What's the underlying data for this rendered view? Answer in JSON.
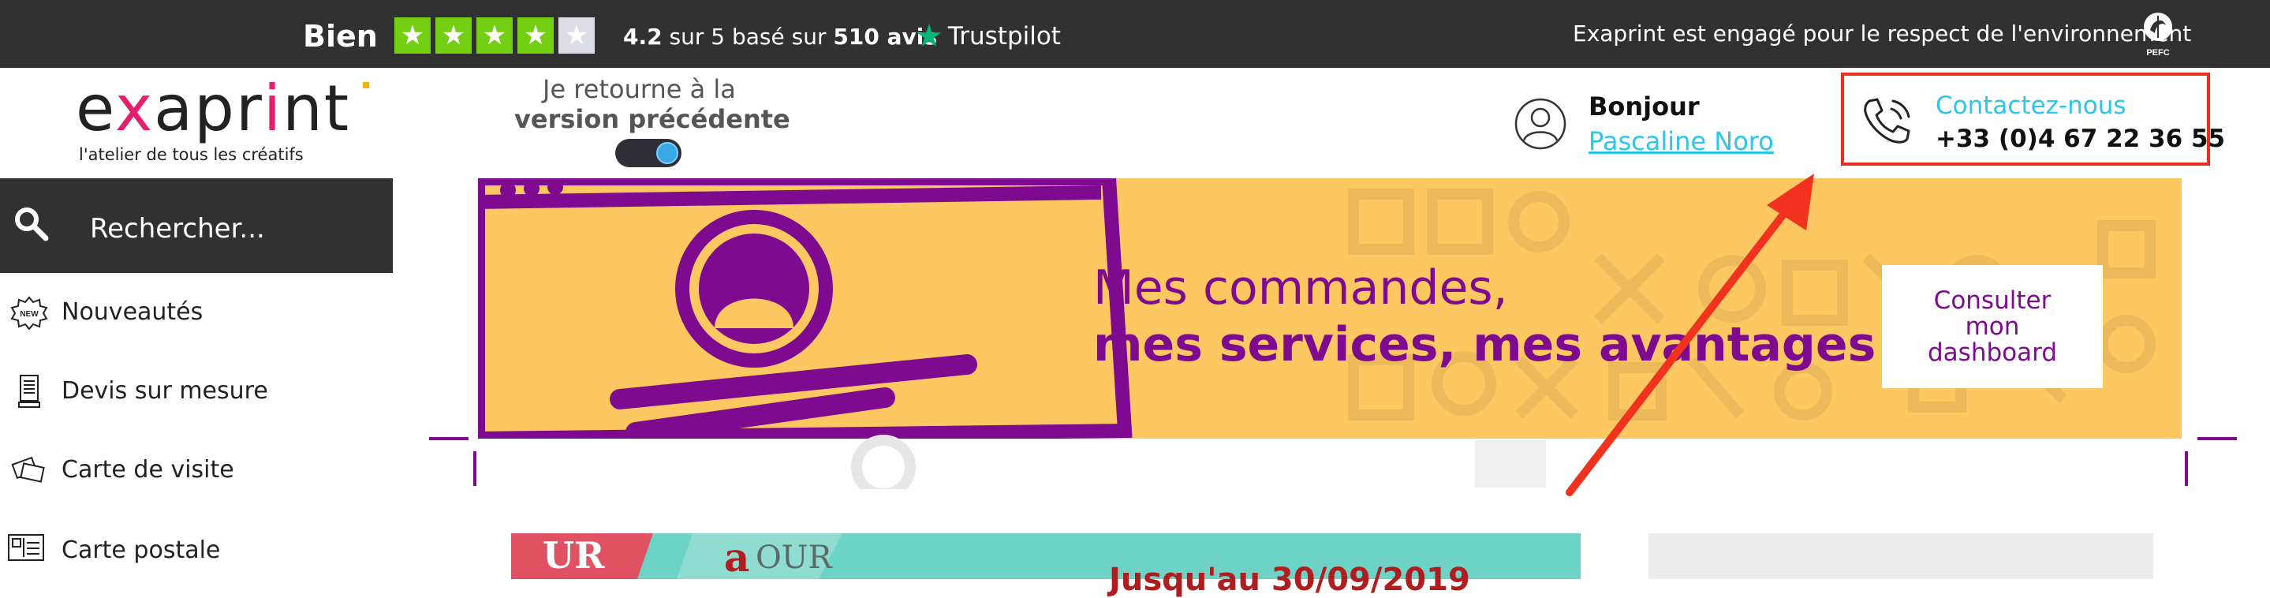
{
  "trustpilot": {
    "rating_word": "Bien",
    "stars_filled": 4,
    "stars_total": 5,
    "score_text": "4.2",
    "summary_mid": " sur 5 basé sur ",
    "review_count": "510 avis",
    "brand": "Trustpilot"
  },
  "environment": {
    "text": "Exaprint est engagé pour le respect de l'environnement",
    "badge_label": "PEFC"
  },
  "header": {
    "logo": {
      "a": "e",
      "x": "x",
      "rest": "apr",
      "i": "i",
      "nt": "nt"
    },
    "logo_tagline": "l'atelier de tous les créatifs",
    "previous_version": {
      "line1": "Je retourne à la",
      "line2": "version précédente"
    },
    "user": {
      "greeting": "Bonjour",
      "name": "Pascaline Noro"
    },
    "contact": {
      "label": "Contactez-nous",
      "phone": "+33 (0)4 67 22 36 55"
    }
  },
  "sidebar": {
    "search_placeholder": "Rechercher...",
    "items": [
      {
        "label": "Nouveautés",
        "icon": "new-badge-icon"
      },
      {
        "label": "Devis sur mesure",
        "icon": "document-icon"
      },
      {
        "label": "Carte de visite",
        "icon": "cards-icon"
      },
      {
        "label": "Carte postale",
        "icon": "postcard-icon"
      }
    ]
  },
  "banner": {
    "line1": "Mes commandes,",
    "line2": "mes services, mes avantages",
    "button": "Consulter\nmon\ndashboard"
  },
  "promo": {
    "text": "Jusqu'au 30/09/2019"
  },
  "colors": {
    "topbar": "#313131",
    "trustpilot_green": "#73cf11",
    "accent_cyan": "#2cc6e6",
    "banner_yellow": "#fdc862",
    "banner_purple": "#7e0a8f",
    "highlight_red": "#e8301f"
  }
}
